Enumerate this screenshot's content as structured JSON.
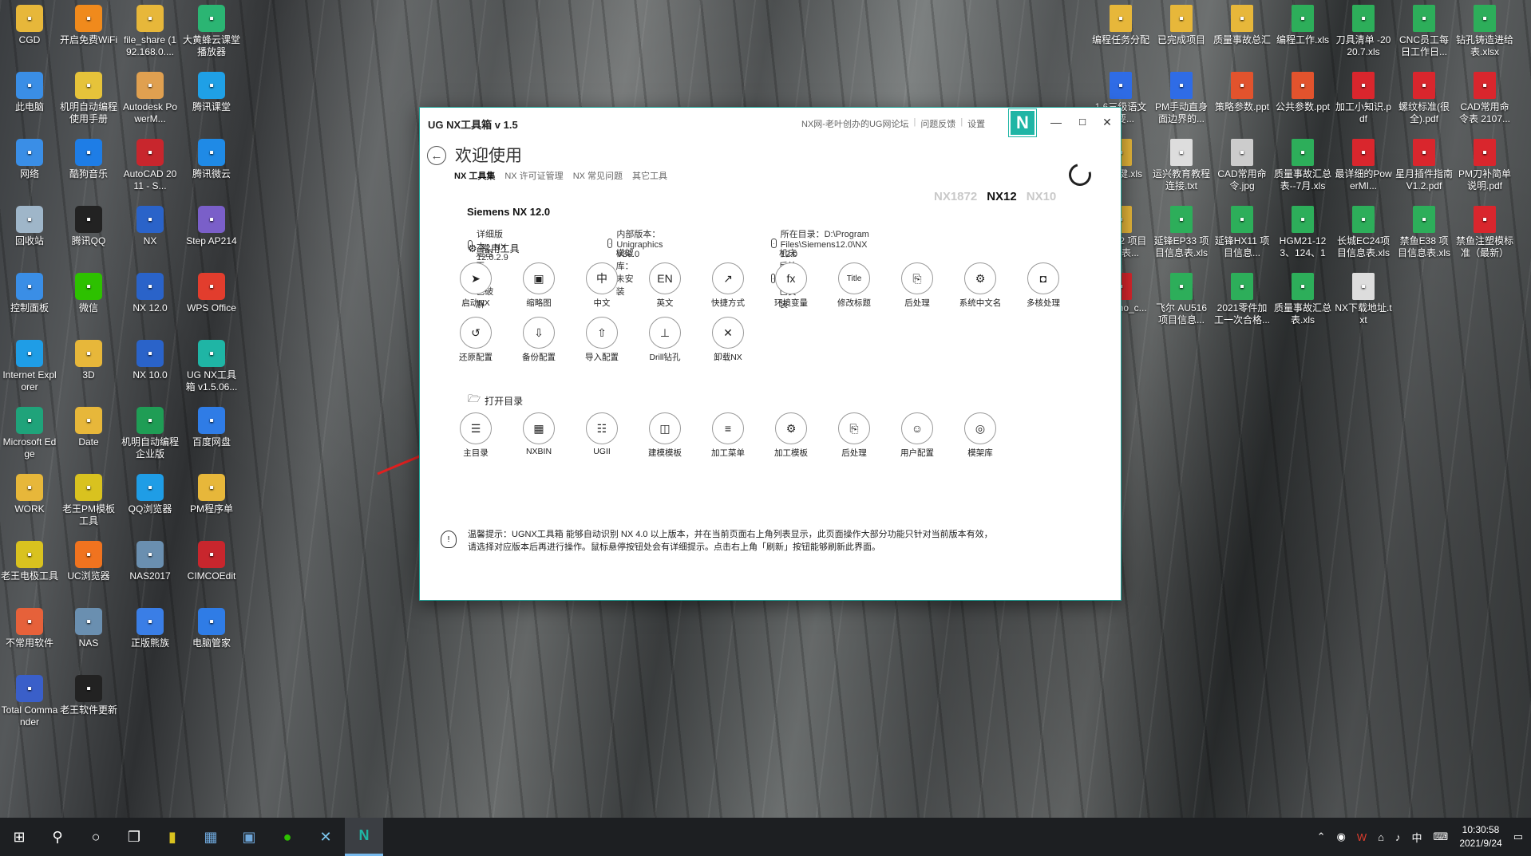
{
  "desktop_left": [
    {
      "label": "CGD",
      "icon": "folder-icon",
      "color": "#e7b73a"
    },
    {
      "label": "开启免费WiFi",
      "icon": "wifi-icon",
      "color": "#f08a1c"
    },
    {
      "label": "file_share (192.168.0....",
      "icon": "folder-share-icon",
      "color": "#e7b73a"
    },
    {
      "label": "大黄蜂云课堂播放器",
      "icon": "player-icon",
      "color": "#2bb573"
    },
    {
      "label": "此电脑",
      "icon": "computer-icon",
      "color": "#3a8ee6"
    },
    {
      "label": "机明自动编程使用手册",
      "icon": "help-icon",
      "color": "#e6c33a"
    },
    {
      "label": "Autodesk PowerM...",
      "icon": "powermill-icon",
      "color": "#e0a050"
    },
    {
      "label": "腾讯课堂",
      "icon": "tencent-class-icon",
      "color": "#1fa0e6"
    },
    {
      "label": "网络",
      "icon": "network-icon",
      "color": "#3a8ee6"
    },
    {
      "label": "酷狗音乐",
      "icon": "kugou-icon",
      "color": "#1e7de6"
    },
    {
      "label": "AutoCAD 2011 - S...",
      "icon": "autocad-icon",
      "color": "#c8262d"
    },
    {
      "label": "腾讯微云",
      "icon": "weiyun-icon",
      "color": "#1f8ae6"
    },
    {
      "label": "回收站",
      "icon": "recycle-bin-icon",
      "color": "#9fb6c9"
    },
    {
      "label": "腾讯QQ",
      "icon": "qq-icon",
      "color": "#222222"
    },
    {
      "label": "NX",
      "icon": "nx-icon",
      "color": "#2a63c9"
    },
    {
      "label": "Step AP214",
      "icon": "step-icon",
      "color": "#7a5fc9"
    },
    {
      "label": "控制面板",
      "icon": "control-panel-icon",
      "color": "#3a8ee6"
    },
    {
      "label": "微信",
      "icon": "wechat-icon",
      "color": "#2dc100"
    },
    {
      "label": "NX 12.0",
      "icon": "nx-icon",
      "color": "#2a63c9"
    },
    {
      "label": "WPS Office",
      "icon": "wps-icon",
      "color": "#e23d2d"
    },
    {
      "label": "Internet Explorer",
      "icon": "ie-icon",
      "color": "#1f9de6"
    },
    {
      "label": "3D",
      "icon": "folder-icon",
      "color": "#e7b73a"
    },
    {
      "label": "NX 10.0",
      "icon": "nx-icon",
      "color": "#2a63c9"
    },
    {
      "label": "UG NX工具箱 v1.5.06...",
      "icon": "ugnx-toolbox-icon",
      "color": "#1fb5a5"
    },
    {
      "label": "Microsoft Edge",
      "icon": "edge-icon",
      "color": "#1fa37a"
    },
    {
      "label": "Date",
      "icon": "folder-icon",
      "color": "#e7b73a"
    },
    {
      "label": "机明自动编程企业版",
      "icon": "excel-like-icon",
      "color": "#1f9d55"
    },
    {
      "label": "百度网盘",
      "icon": "baidu-netdisk-icon",
      "color": "#2f7ce6"
    },
    {
      "label": "WORK",
      "icon": "folder-icon",
      "color": "#e7b73a"
    },
    {
      "label": "老王PM模板工具",
      "icon": "pm-tool-icon",
      "color": "#d9c21f"
    },
    {
      "label": "QQ浏览器",
      "icon": "qq-browser-icon",
      "color": "#1f9de6"
    },
    {
      "label": "PM程序单",
      "icon": "folder-icon",
      "color": "#e7b73a"
    },
    {
      "label": "老王电极工具",
      "icon": "electrode-tool-icon",
      "color": "#d9c21f"
    },
    {
      "label": "UC浏览器",
      "icon": "uc-browser-icon",
      "color": "#f0731f"
    },
    {
      "label": "NAS2017",
      "icon": "nas-icon",
      "color": "#6a8fb0"
    },
    {
      "label": "CIMCOEdit",
      "icon": "cimco-icon",
      "color": "#c8262d"
    },
    {
      "label": "不常用软件",
      "icon": "app-icon",
      "color": "#e6613a"
    },
    {
      "label": "NAS",
      "icon": "nas-icon",
      "color": "#6a8fb0"
    },
    {
      "label": "正版熊族",
      "icon": "bear-icon",
      "color": "#3a7ee6"
    },
    {
      "label": "电脑管家",
      "icon": "pc-manager-icon",
      "color": "#2f7ce6"
    },
    {
      "label": "Total Commander",
      "icon": "total-commander-icon",
      "color": "#3a5fc9"
    },
    {
      "label": "老王软件更新",
      "icon": "update-icon",
      "color": "#222222"
    }
  ],
  "desktop_right": [
    {
      "label": "编程任务分配",
      "icon": "doc-icon",
      "color": "#e7b73a"
    },
    {
      "label": "已完成项目",
      "icon": "doc-icon",
      "color": "#e7b73a"
    },
    {
      "label": "质量事故总汇",
      "icon": "doc-icon",
      "color": "#e7b73a"
    },
    {
      "label": "编程工作.xls",
      "icon": "sheet-icon",
      "color": "#2dae5a"
    },
    {
      "label": "刀具清单 -2020.7.xls",
      "icon": "sheet-icon",
      "color": "#2dae5a"
    },
    {
      "label": "CNC员工每日工作日...",
      "icon": "sheet-icon",
      "color": "#2dae5a"
    },
    {
      "label": "钻孔铸造进给表.xlsx",
      "icon": "sheet-icon",
      "color": "#2dae5a"
    },
    {
      "label": "1.6三级语文识要...",
      "icon": "word-icon",
      "color": "#2f6ce6"
    },
    {
      "label": "PM手动直身面边界的...",
      "icon": "word-icon",
      "color": "#2f6ce6"
    },
    {
      "label": "策略参数.ppt",
      "icon": "ppt-icon",
      "color": "#e2532d"
    },
    {
      "label": "公共参数.ppt",
      "icon": "ppt-icon",
      "color": "#e2532d"
    },
    {
      "label": "加工小知识.pdf",
      "icon": "pdf-icon",
      "color": "#d9262d"
    },
    {
      "label": "螺纹标准(很全).pdf",
      "icon": "pdf-icon",
      "color": "#d9262d"
    },
    {
      "label": "CAD常用命令表 2107...",
      "icon": "pdf-icon",
      "color": "#d9262d"
    },
    {
      "label": "快捷键.xls",
      "icon": "doc-icon",
      "color": "#e7b73a"
    },
    {
      "label": "运兴教育教程连接.txt",
      "icon": "txt-icon",
      "color": "#dddddd"
    },
    {
      "label": "CAD常用命令.jpg",
      "icon": "image-icon",
      "color": "#cccccc"
    },
    {
      "label": "质量事故汇总表--7月.xls",
      "icon": "sheet-icon",
      "color": "#2dae5a"
    },
    {
      "label": "最详细的PowerMI...",
      "icon": "pdf-icon",
      "color": "#d9262d"
    },
    {
      "label": "星月插件指南 V1.2.pdf",
      "icon": "pdf-icon",
      "color": "#d9262d"
    },
    {
      "label": "PM刀补简单说明.pdf",
      "icon": "pdf-icon",
      "color": "#d9262d"
    },
    {
      "label": "21-122 项目信息表...",
      "icon": "doc-icon",
      "color": "#e7b73a"
    },
    {
      "label": "延锋EP33 项目信息表.xls",
      "icon": "sheet-icon",
      "color": "#2dae5a"
    },
    {
      "label": "延锋HX11 项目信息...",
      "icon": "sheet-icon",
      "color": "#2dae5a"
    },
    {
      "label": "HGM21-123、124、12...",
      "icon": "sheet-icon",
      "color": "#2dae5a"
    },
    {
      "label": "长城EC24项目信息表.xls",
      "icon": "sheet-icon",
      "color": "#2dae5a"
    },
    {
      "label": "禁鱼E38 项目信息表.xls",
      "icon": "sheet-icon",
      "color": "#2dae5a"
    },
    {
      "label": "禁鱼注塑模标准（最新）",
      "icon": "pdf-icon",
      "color": "#d9262d"
    },
    {
      "label": "s_mono_c...",
      "icon": "pdf-icon",
      "color": "#d9262d"
    },
    {
      "label": "飞尔 AU516 项目信息...",
      "icon": "sheet-icon",
      "color": "#2dae5a"
    },
    {
      "label": "2021零件加工一次合格...",
      "icon": "sheet-icon",
      "color": "#2dae5a"
    },
    {
      "label": "质量事故汇总表.xls",
      "icon": "sheet-icon",
      "color": "#2dae5a"
    },
    {
      "label": "NX下载地址.txt",
      "icon": "txt-icon",
      "color": "#dddddd"
    }
  ],
  "window": {
    "title": "UG NX工具箱 v 1.5",
    "links": [
      "NX网-老叶创办的UG网论坛",
      "|",
      "问题反馈",
      "|",
      "设置"
    ],
    "logo": "N",
    "minimize": "—",
    "maximize": "☐",
    "close": "✕",
    "back_glyph": "←",
    "welcome": "欢迎使用",
    "tabs": [
      "NX 工具集",
      "NX 许可证管理",
      "NX 常见问题",
      "其它工具"
    ],
    "versions": [
      "NX1872",
      "NX12",
      "NX10"
    ],
    "active_version": "NX12",
    "product": "Siemens NX 12.0",
    "info": [
      {
        "icon": "version-icon",
        "text": "详细版本：NX 12.0.2.9"
      },
      {
        "icon": "internal-version-icon",
        "text": "内部版本：Unigraphics V30.0"
      },
      {
        "icon": "folder-path-icon",
        "text": "所在目录：D:\\Program Files\\Siemens12.0\\NX 12.0"
      },
      {
        "icon": "key-icon",
        "text": "是否正版：已破解"
      },
      {
        "icon": "template-icon",
        "text": "模架库：未安装"
      },
      {
        "icon": "postprocess-icon",
        "text": "机床后处理：已安装"
      }
    ],
    "section_common": "常用工具",
    "section_open": "打开目录",
    "common_tools": [
      {
        "label": "启动NX",
        "glyph": "➤",
        "name": "launch-nx"
      },
      {
        "label": "缩略图",
        "glyph": "▣",
        "name": "thumbnail"
      },
      {
        "label": "中文",
        "glyph": "中",
        "name": "chinese"
      },
      {
        "label": "英文",
        "glyph": "EN",
        "name": "english"
      },
      {
        "label": "快捷方式",
        "glyph": "↗",
        "name": "shortcut"
      },
      {
        "label": "环境变量",
        "glyph": "fx",
        "name": "env-vars"
      },
      {
        "label": "修改标题",
        "glyph": "Title",
        "name": "edit-title"
      },
      {
        "label": "后处理",
        "glyph": "⎘",
        "name": "postprocess"
      },
      {
        "label": "系统中文名",
        "glyph": "⚙",
        "name": "system-chinese-name"
      },
      {
        "label": "多核处理",
        "glyph": "◘",
        "name": "multicore"
      },
      {
        "label": "还原配置",
        "glyph": "↺",
        "name": "restore-config"
      },
      {
        "label": "备份配置",
        "glyph": "⇩",
        "name": "backup-config"
      },
      {
        "label": "导入配置",
        "glyph": "⇧",
        "name": "import-config"
      },
      {
        "label": "Drill钻孔",
        "glyph": "⊥",
        "name": "drill"
      },
      {
        "label": "卸载NX",
        "glyph": "✕",
        "name": "uninstall-nx"
      }
    ],
    "open_tools": [
      {
        "label": "主目录",
        "glyph": "☰",
        "name": "main-dir"
      },
      {
        "label": "NXBIN",
        "glyph": "▦",
        "name": "nxbin"
      },
      {
        "label": "UGII",
        "glyph": "☷",
        "name": "ugii"
      },
      {
        "label": "建模模板",
        "glyph": "◫",
        "name": "modeling-template"
      },
      {
        "label": "加工菜单",
        "glyph": "≡",
        "name": "machining-menu"
      },
      {
        "label": "加工模板",
        "glyph": "⚙",
        "name": "machining-template"
      },
      {
        "label": "后处理",
        "glyph": "⎘",
        "name": "open-postprocess"
      },
      {
        "label": "用户配置",
        "glyph": "☺",
        "name": "user-config"
      },
      {
        "label": "模架库",
        "glyph": "◎",
        "name": "mold-library"
      }
    ],
    "tip_line1": "温馨提示：UGNX工具箱 能够自动识别 NX 4.0 以上版本，并在当前页面右上角列表显示，此页面操作大部分功能只针对当前版本有效，",
    "tip_line2": "请选择对应版本后再进行操作。鼠标悬停按钮处会有详细提示。点击右上角「刷新」按钮能够刷新此界面。"
  },
  "taskbar": {
    "clock_time": "10:30:58",
    "clock_date": "2021/9/24",
    "ime": "中",
    "icons": [
      "start-icon",
      "search-icon",
      "cortana-icon",
      "task-view-icon",
      "pm-tool-icon",
      "calculator-icon",
      "save-icon",
      "wechat-icon",
      "browser-icon",
      "ugnx-toolbox-icon"
    ]
  }
}
